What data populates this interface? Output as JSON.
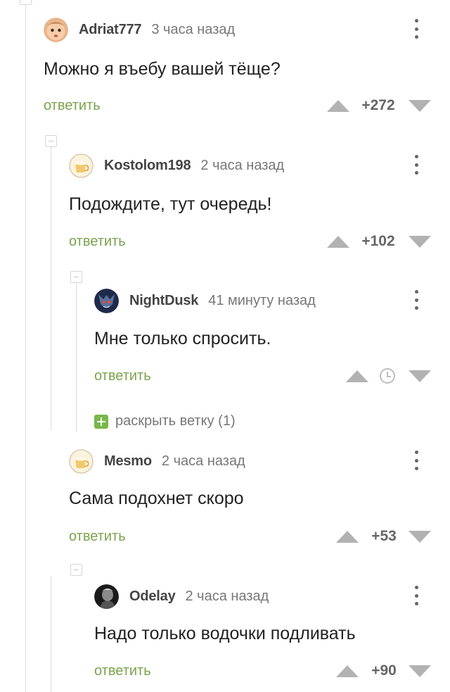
{
  "reply_label": "ответить",
  "colors": {
    "accent": "#7ba34d",
    "meta": "#777777",
    "vote": "#b2b2b2",
    "expand": "#7ab84a"
  },
  "comments": [
    {
      "author": "Adriat777",
      "time": "3 часа назад",
      "text": "Можно я въебу вашей тёще?",
      "score": "+272",
      "avatar": "baby-face"
    },
    {
      "author": "Kostolom198",
      "time": "2 часа назад",
      "text": "Подождите, тут очередь!",
      "score": "+102",
      "avatar": "default-cup"
    },
    {
      "author": "NightDusk",
      "time": "41 минуту назад",
      "text": "Мне только спросить.",
      "score": "",
      "score_icon": "clock-icon",
      "avatar": "dark-creature"
    },
    {
      "author": "Mesmo",
      "time": "2 часа назад",
      "text": "Сама подохнет скоро",
      "score": "+53",
      "avatar": "default-cup"
    },
    {
      "author": "Odelay",
      "time": "2 часа назад",
      "text": "Надо только водочки подливать",
      "score": "+90",
      "avatar": "dark-portrait"
    }
  ],
  "expand_branch": {
    "label": "раскрыть ветку (1)"
  }
}
